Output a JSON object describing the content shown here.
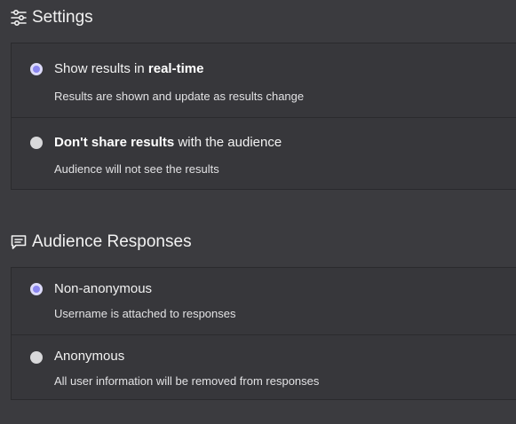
{
  "settings": {
    "title": "Settings",
    "icon": "sliders-icon",
    "options": [
      {
        "title_prefix": "Show results in ",
        "title_bold": "real-time",
        "title_suffix": "",
        "description": "Results are shown and update as results change",
        "selected": true
      },
      {
        "title_prefix": "",
        "title_bold": "Don't share results",
        "title_suffix": " with the audience",
        "description": "Audience will not see the results",
        "selected": false
      }
    ]
  },
  "audience": {
    "title": "Audience Responses",
    "icon": "message-square-icon",
    "options": [
      {
        "title": "Non-anonymous",
        "description": "Username is attached to responses",
        "selected": true
      },
      {
        "title": "Anonymous",
        "description": "All user information will be removed from responses",
        "selected": false
      }
    ]
  },
  "colors": {
    "background": "#3b3b3f",
    "card": "#37373b",
    "accent": "#8b86f0"
  }
}
